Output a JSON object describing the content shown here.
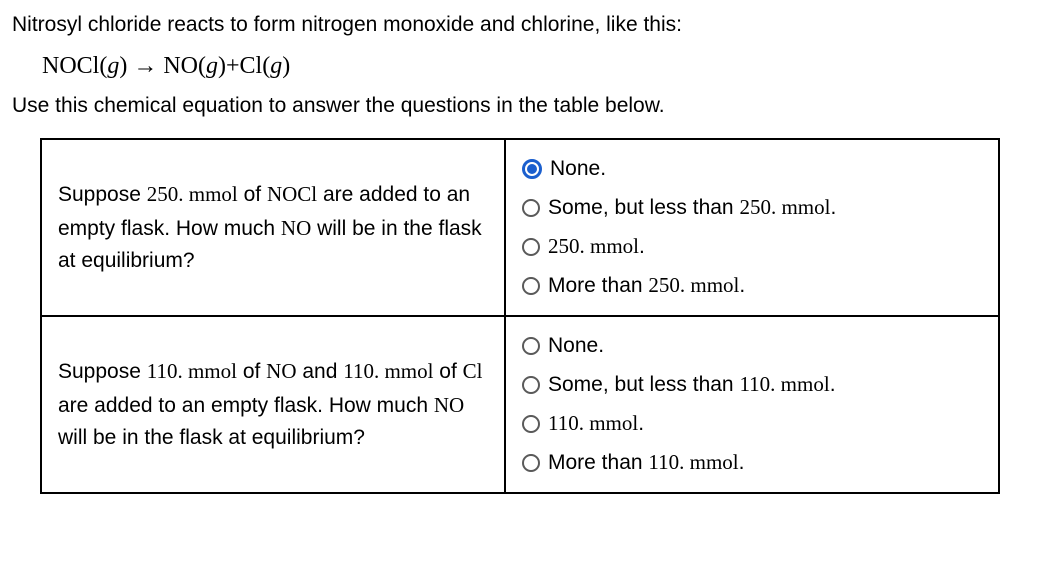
{
  "intro": "Nitrosyl chloride reacts to form nitrogen monoxide and chlorine, like this:",
  "equation_html": "NOCl(<i>g</i>) → NO(<i>g</i>)+Cl(<i>g</i>)",
  "subintro": "Use this chemical equation to answer the questions in the table below.",
  "questions": [
    {
      "prompt_html": "Suppose <span class='chem'>250. mmol</span> of <span class='chem'>NOCl</span> are added to an empty flask. How much <span class='chem'>NO</span> will be in the flask at equilibrium?",
      "options": [
        {
          "label_html": "None.",
          "selected": true
        },
        {
          "label_html": "Some, but less than <span class='unit'>250. mmol</span>.",
          "selected": false
        },
        {
          "label_html": "<span class='unit'>250. mmol</span>.",
          "selected": false
        },
        {
          "label_html": "More than <span class='unit'>250. mmol</span>.",
          "selected": false
        }
      ]
    },
    {
      "prompt_html": "Suppose <span class='chem'>110. mmol</span> of <span class='chem'>NO</span> and <span class='chem'>110. mmol</span> of <span class='chem'>Cl</span> are added to an empty flask. How much <span class='chem'>NO</span> will be in the flask at equilibrium?",
      "options": [
        {
          "label_html": "None.",
          "selected": false
        },
        {
          "label_html": "Some, but less than <span class='unit'>110. mmol</span>.",
          "selected": false
        },
        {
          "label_html": "<span class='unit'>110. mmol</span>.",
          "selected": false
        },
        {
          "label_html": "More than <span class='unit'>110. mmol</span>.",
          "selected": false
        }
      ]
    }
  ]
}
